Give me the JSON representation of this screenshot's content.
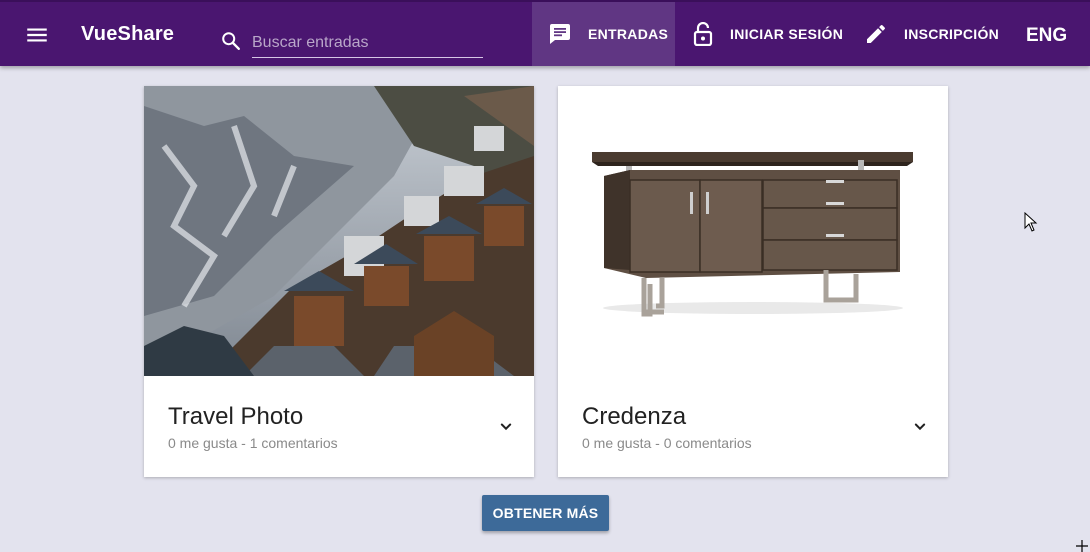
{
  "app": {
    "title": "VueShare"
  },
  "search": {
    "placeholder": "Buscar entradas",
    "value": ""
  },
  "nav": {
    "items": [
      {
        "label": "ENTRADAS",
        "icon": "message-icon",
        "active": true
      },
      {
        "label": "INICIAR SESIÓN",
        "icon": "lock-open-icon",
        "active": false
      },
      {
        "label": "INSCRIPCIÓN",
        "icon": "pencil-icon",
        "active": false
      }
    ],
    "language": "ENG"
  },
  "posts": [
    {
      "title": "Travel Photo",
      "likes": "0 me gusta",
      "separator": " - ",
      "comments": "1 comentarios",
      "image": "mountain-village-photo"
    },
    {
      "title": "Credenza",
      "likes": "0 me gusta",
      "separator": " - ",
      "comments": "0 comentarios",
      "image": "credenza-furniture-photo"
    }
  ],
  "load_more": {
    "label": "OBTENER MÁS"
  },
  "colors": {
    "toolbar": "#4a1670",
    "toolbar_active": "#603683",
    "background": "#e3e3ee",
    "button": "#3d6a99"
  }
}
